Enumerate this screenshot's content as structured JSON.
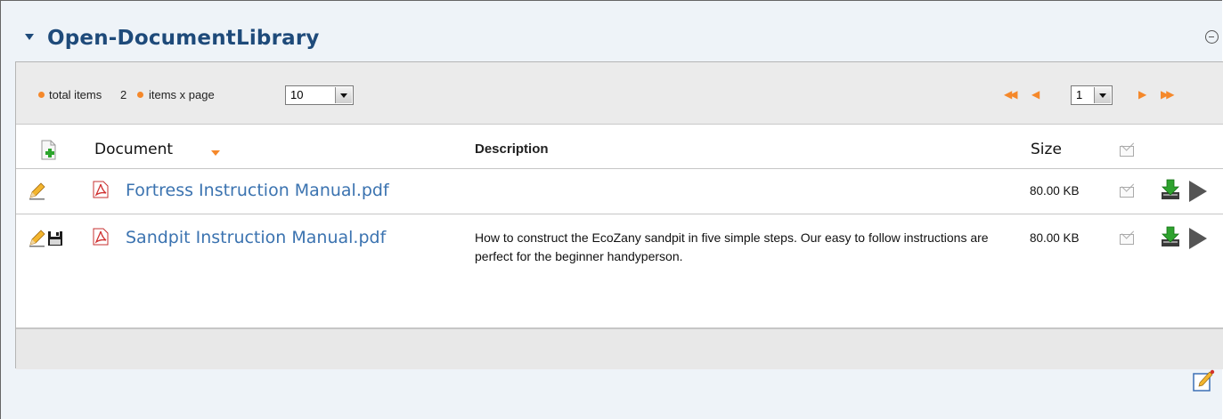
{
  "portlet": {
    "title": "Open-DocumentLibrary"
  },
  "toolbar": {
    "total_items_label": "total items",
    "total_items_value": "2",
    "items_per_page_label": "items x page",
    "items_per_page_value": "10",
    "current_page": "1"
  },
  "columns": {
    "document": "Document",
    "description": "Description",
    "size": "Size"
  },
  "documents": [
    {
      "name": "Fortress Instruction Manual.pdf",
      "description": "",
      "size": "80.00 KB"
    },
    {
      "name": "Sandpit Instruction Manual.pdf",
      "description": "How to construct the EcoZany sandpit in five simple steps. Our easy to follow instructions are perfect for the beginner handyperson.",
      "size": "80.00 KB"
    }
  ],
  "colors": {
    "title": "#1e4a7a",
    "link": "#3b73b0",
    "accent": "#f5882a",
    "panel_bg": "#eef3f8"
  },
  "icons": [
    "chevron-down-icon",
    "minimize-icon",
    "first-page-icon",
    "prev-page-icon",
    "next-page-icon",
    "last-page-icon",
    "add-document-icon",
    "sort-arrow-icon",
    "mail-icon",
    "edit-pencil-icon",
    "pdf-icon",
    "save-icon",
    "download-icon",
    "play-icon",
    "edit-portlet-icon"
  ]
}
